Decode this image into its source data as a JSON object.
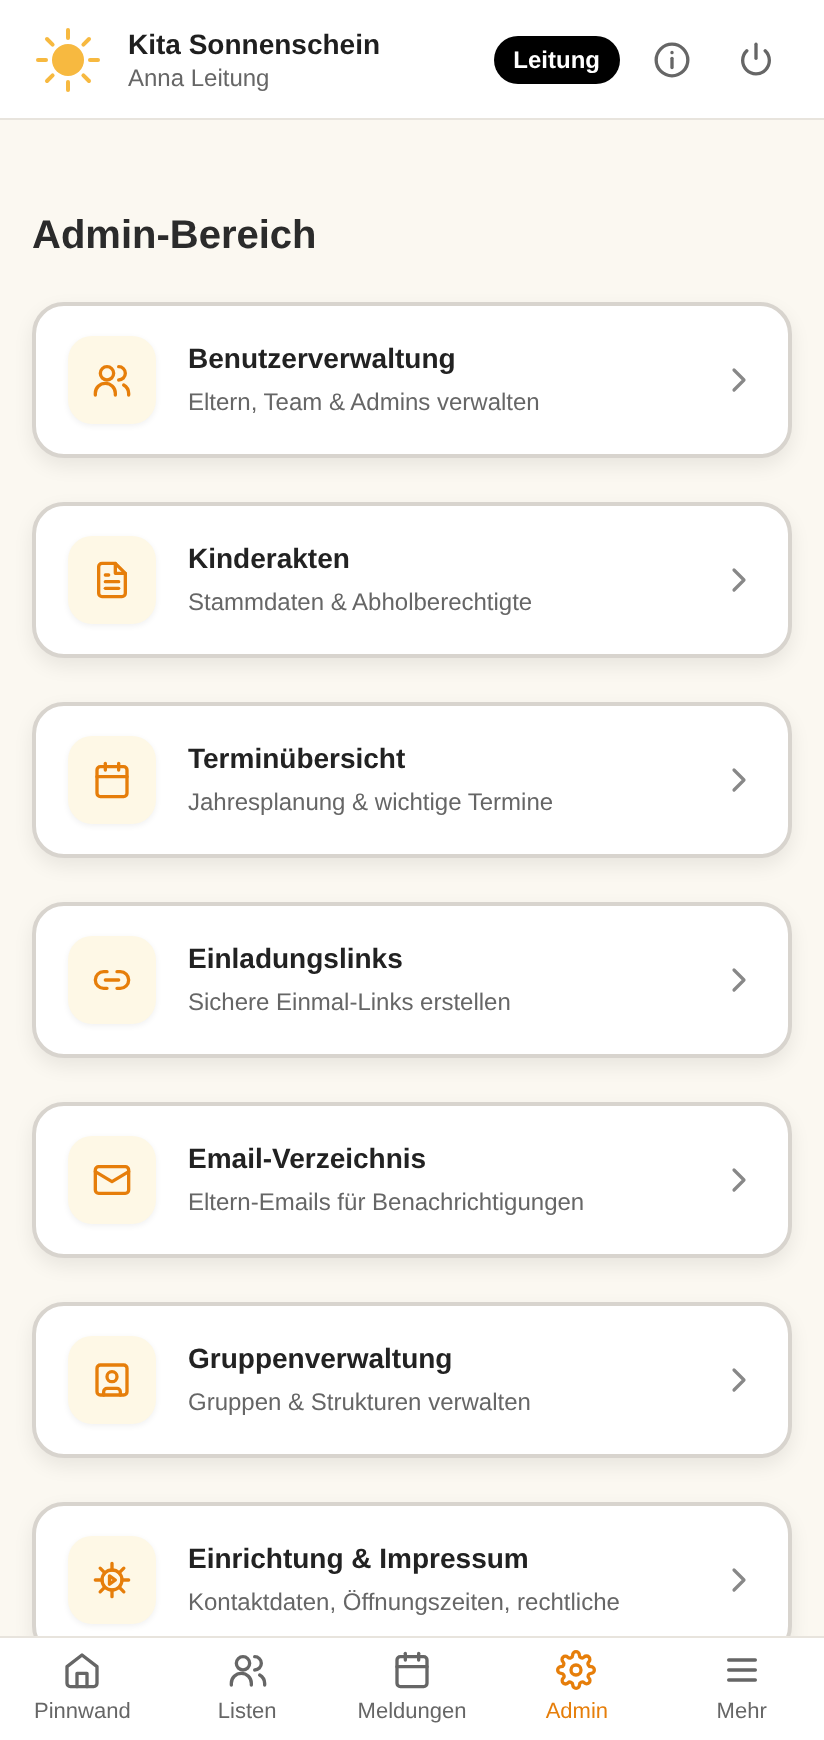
{
  "header": {
    "title": "Kita Sonnenschein",
    "subtitle": "Anna Leitung",
    "role_badge": "Leitung"
  },
  "page_title": "Admin-Bereich",
  "items": [
    {
      "title": "Benutzerverwaltung",
      "subtitle": "Eltern, Team & Admins verwalten"
    },
    {
      "title": "Kinderakten",
      "subtitle": "Stammdaten & Abholberechtigte"
    },
    {
      "title": "Terminübersicht",
      "subtitle": "Jahresplanung & wichtige Termine"
    },
    {
      "title": "Einladungslinks",
      "subtitle": "Sichere Einmal-Links erstellen"
    },
    {
      "title": "Email-Verzeichnis",
      "subtitle": "Eltern-Emails für Benachrichtigungen"
    },
    {
      "title": "Gruppenverwaltung",
      "subtitle": "Gruppen & Strukturen verwalten"
    },
    {
      "title": "Einrichtung & Impressum",
      "subtitle": "Kontaktdaten, Öffnungszeiten, rechtliche"
    }
  ],
  "nav": [
    {
      "label": "Pinnwand",
      "selected": false
    },
    {
      "label": "Listen",
      "selected": false
    },
    {
      "label": "Meldungen",
      "selected": false
    },
    {
      "label": "Admin",
      "selected": true
    },
    {
      "label": "Mehr",
      "selected": false
    }
  ]
}
